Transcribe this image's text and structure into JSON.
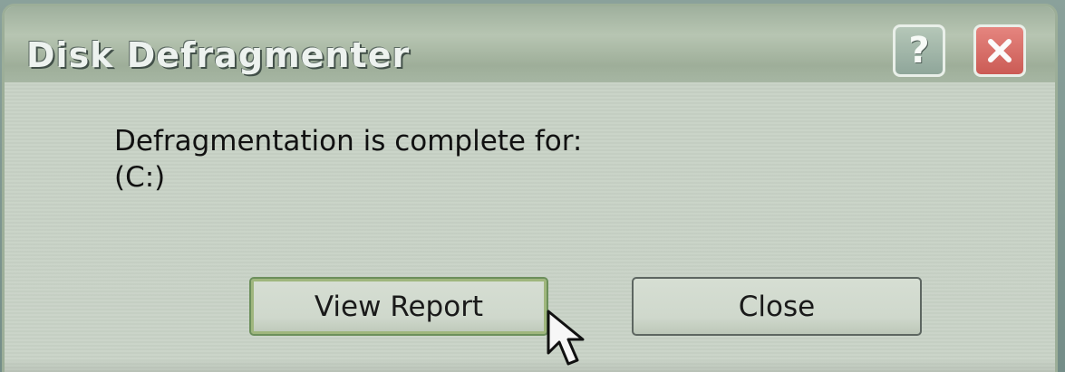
{
  "window": {
    "title": "Disk Defragmenter",
    "help_label": "?",
    "close_label": "✕"
  },
  "message": {
    "line1": "Defragmentation is complete for:",
    "line2": "(C:)"
  },
  "buttons": {
    "view_report": "View Report",
    "close": "Close"
  },
  "colors": {
    "title_text": "#edf2ef",
    "dialog_body": "#c8d3c5",
    "help_button": "#8fa69a",
    "close_button": "#cb5b55",
    "focused_button_border": "#6c8f5b"
  },
  "icons": {
    "help": "help-icon",
    "close": "close-icon",
    "pointer": "mouse-pointer-icon"
  }
}
